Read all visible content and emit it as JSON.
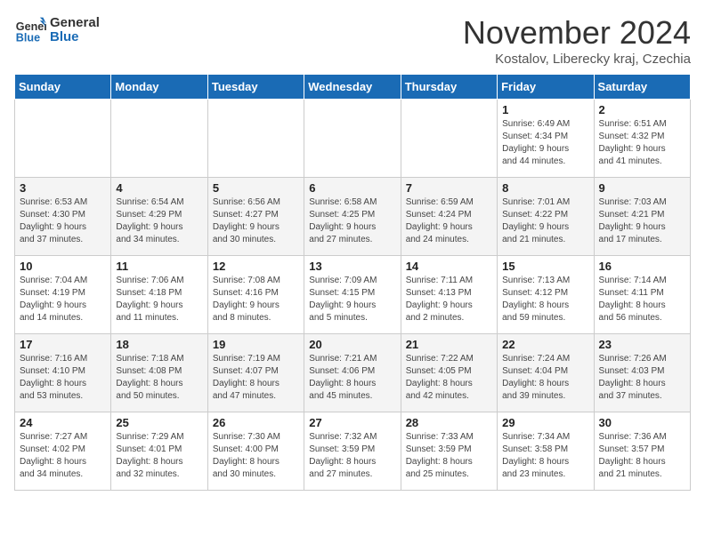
{
  "header": {
    "logo_line1": "General",
    "logo_line2": "Blue",
    "title": "November 2024",
    "subtitle": "Kostalov, Liberecky kraj, Czechia"
  },
  "weekdays": [
    "Sunday",
    "Monday",
    "Tuesday",
    "Wednesday",
    "Thursday",
    "Friday",
    "Saturday"
  ],
  "weeks": [
    [
      {
        "day": "",
        "info": ""
      },
      {
        "day": "",
        "info": ""
      },
      {
        "day": "",
        "info": ""
      },
      {
        "day": "",
        "info": ""
      },
      {
        "day": "",
        "info": ""
      },
      {
        "day": "1",
        "info": "Sunrise: 6:49 AM\nSunset: 4:34 PM\nDaylight: 9 hours\nand 44 minutes."
      },
      {
        "day": "2",
        "info": "Sunrise: 6:51 AM\nSunset: 4:32 PM\nDaylight: 9 hours\nand 41 minutes."
      }
    ],
    [
      {
        "day": "3",
        "info": "Sunrise: 6:53 AM\nSunset: 4:30 PM\nDaylight: 9 hours\nand 37 minutes."
      },
      {
        "day": "4",
        "info": "Sunrise: 6:54 AM\nSunset: 4:29 PM\nDaylight: 9 hours\nand 34 minutes."
      },
      {
        "day": "5",
        "info": "Sunrise: 6:56 AM\nSunset: 4:27 PM\nDaylight: 9 hours\nand 30 minutes."
      },
      {
        "day": "6",
        "info": "Sunrise: 6:58 AM\nSunset: 4:25 PM\nDaylight: 9 hours\nand 27 minutes."
      },
      {
        "day": "7",
        "info": "Sunrise: 6:59 AM\nSunset: 4:24 PM\nDaylight: 9 hours\nand 24 minutes."
      },
      {
        "day": "8",
        "info": "Sunrise: 7:01 AM\nSunset: 4:22 PM\nDaylight: 9 hours\nand 21 minutes."
      },
      {
        "day": "9",
        "info": "Sunrise: 7:03 AM\nSunset: 4:21 PM\nDaylight: 9 hours\nand 17 minutes."
      }
    ],
    [
      {
        "day": "10",
        "info": "Sunrise: 7:04 AM\nSunset: 4:19 PM\nDaylight: 9 hours\nand 14 minutes."
      },
      {
        "day": "11",
        "info": "Sunrise: 7:06 AM\nSunset: 4:18 PM\nDaylight: 9 hours\nand 11 minutes."
      },
      {
        "day": "12",
        "info": "Sunrise: 7:08 AM\nSunset: 4:16 PM\nDaylight: 9 hours\nand 8 minutes."
      },
      {
        "day": "13",
        "info": "Sunrise: 7:09 AM\nSunset: 4:15 PM\nDaylight: 9 hours\nand 5 minutes."
      },
      {
        "day": "14",
        "info": "Sunrise: 7:11 AM\nSunset: 4:13 PM\nDaylight: 9 hours\nand 2 minutes."
      },
      {
        "day": "15",
        "info": "Sunrise: 7:13 AM\nSunset: 4:12 PM\nDaylight: 8 hours\nand 59 minutes."
      },
      {
        "day": "16",
        "info": "Sunrise: 7:14 AM\nSunset: 4:11 PM\nDaylight: 8 hours\nand 56 minutes."
      }
    ],
    [
      {
        "day": "17",
        "info": "Sunrise: 7:16 AM\nSunset: 4:10 PM\nDaylight: 8 hours\nand 53 minutes."
      },
      {
        "day": "18",
        "info": "Sunrise: 7:18 AM\nSunset: 4:08 PM\nDaylight: 8 hours\nand 50 minutes."
      },
      {
        "day": "19",
        "info": "Sunrise: 7:19 AM\nSunset: 4:07 PM\nDaylight: 8 hours\nand 47 minutes."
      },
      {
        "day": "20",
        "info": "Sunrise: 7:21 AM\nSunset: 4:06 PM\nDaylight: 8 hours\nand 45 minutes."
      },
      {
        "day": "21",
        "info": "Sunrise: 7:22 AM\nSunset: 4:05 PM\nDaylight: 8 hours\nand 42 minutes."
      },
      {
        "day": "22",
        "info": "Sunrise: 7:24 AM\nSunset: 4:04 PM\nDaylight: 8 hours\nand 39 minutes."
      },
      {
        "day": "23",
        "info": "Sunrise: 7:26 AM\nSunset: 4:03 PM\nDaylight: 8 hours\nand 37 minutes."
      }
    ],
    [
      {
        "day": "24",
        "info": "Sunrise: 7:27 AM\nSunset: 4:02 PM\nDaylight: 8 hours\nand 34 minutes."
      },
      {
        "day": "25",
        "info": "Sunrise: 7:29 AM\nSunset: 4:01 PM\nDaylight: 8 hours\nand 32 minutes."
      },
      {
        "day": "26",
        "info": "Sunrise: 7:30 AM\nSunset: 4:00 PM\nDaylight: 8 hours\nand 30 minutes."
      },
      {
        "day": "27",
        "info": "Sunrise: 7:32 AM\nSunset: 3:59 PM\nDaylight: 8 hours\nand 27 minutes."
      },
      {
        "day": "28",
        "info": "Sunrise: 7:33 AM\nSunset: 3:59 PM\nDaylight: 8 hours\nand 25 minutes."
      },
      {
        "day": "29",
        "info": "Sunrise: 7:34 AM\nSunset: 3:58 PM\nDaylight: 8 hours\nand 23 minutes."
      },
      {
        "day": "30",
        "info": "Sunrise: 7:36 AM\nSunset: 3:57 PM\nDaylight: 8 hours\nand 21 minutes."
      }
    ]
  ]
}
